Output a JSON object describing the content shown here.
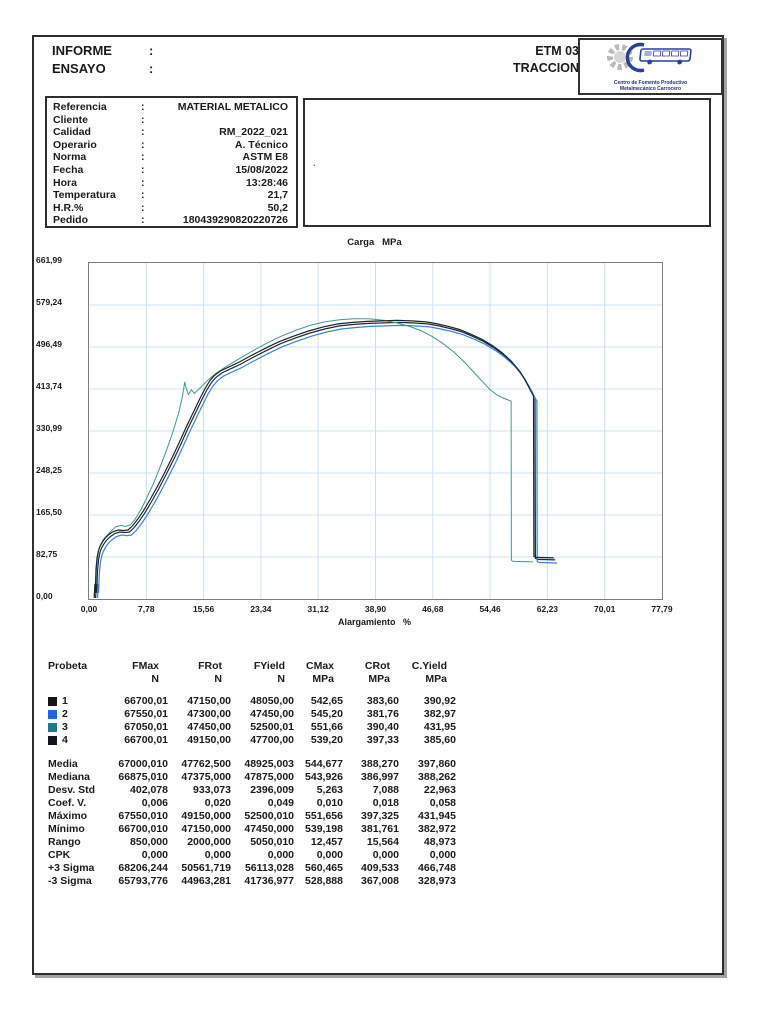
{
  "header": {
    "informe_label": "INFORME",
    "ensayo_label": "ENSAYO",
    "colon": ":",
    "code": "ETM 03",
    "test": "TRACCION",
    "logo_line1": "Centro de Fomento Productivo",
    "logo_line2": "Metalmecánico Carrocero"
  },
  "metadata": {
    "rows": [
      {
        "label": "Referencia",
        "value": "MATERIAL METALICO"
      },
      {
        "label": "Cliente",
        "value": ""
      },
      {
        "label": "Calidad",
        "value": "RM_2022_021"
      },
      {
        "label": "Operario",
        "value": "A. Técnico"
      },
      {
        "label": "Norma",
        "value": "ASTM E8"
      },
      {
        "label": "Fecha",
        "value": "15/08/2022"
      },
      {
        "label": "Hora",
        "value": "13:28:46"
      },
      {
        "label": "Temperatura",
        "value": "21,7"
      },
      {
        "label": "H.R.%",
        "value": "50,2"
      },
      {
        "label": "Pedido",
        "value": "180439290820220726"
      }
    ]
  },
  "note": {
    "dot": "."
  },
  "chart_data": {
    "type": "line",
    "title": "Carga   MPa",
    "xlabel": "Alargamiento   %",
    "ylabel": "Carga MPa",
    "xlim": [
      0,
      77.79
    ],
    "ylim": [
      0,
      661.99
    ],
    "grid": true,
    "x_ticks": [
      "0,00",
      "7,78",
      "15,56",
      "23,34",
      "31,12",
      "38,90",
      "46,68",
      "54,46",
      "62,23",
      "70,01",
      "77,79"
    ],
    "y_ticks": [
      "0,00",
      "82,75",
      "165,50",
      "248,25",
      "330,99",
      "413,74",
      "496,49",
      "579,24",
      "661,99"
    ],
    "grid_color": "#cfe0ef",
    "series": [
      {
        "name": "1",
        "color": "#23272c",
        "point_set": "cluster",
        "dx": 0,
        "dy": 0
      },
      {
        "name": "2",
        "color": "#3b82d8",
        "point_set": "cluster",
        "dx": 0.25,
        "dy": -6
      },
      {
        "name": "3",
        "color": "#43998b",
        "point_set": "probe3",
        "dx": 0,
        "dy": 0
      },
      {
        "name": "4",
        "color": "#182430",
        "point_set": "cluster",
        "dx": -0.2,
        "dy": 4
      }
    ],
    "point_sets": {
      "cluster": [
        [
          0.9,
          2
        ],
        [
          1.0,
          30
        ],
        [
          1.05,
          12
        ],
        [
          1.15,
          55
        ],
        [
          1.3,
          78
        ],
        [
          1.5,
          92
        ],
        [
          1.7,
          100
        ],
        [
          2.0,
          108
        ],
        [
          2.4,
          116
        ],
        [
          2.9,
          123
        ],
        [
          3.5,
          129
        ],
        [
          4.2,
          132
        ],
        [
          4.9,
          131
        ],
        [
          5.5,
          132
        ],
        [
          6.1,
          140
        ],
        [
          6.8,
          153
        ],
        [
          7.6,
          170
        ],
        [
          8.5,
          192
        ],
        [
          9.5,
          218
        ],
        [
          10.5,
          246
        ],
        [
          11.5,
          275
        ],
        [
          12.5,
          306
        ],
        [
          13.5,
          338
        ],
        [
          14.5,
          368
        ],
        [
          15.3,
          392
        ],
        [
          16.0,
          412
        ],
        [
          16.6,
          426
        ],
        [
          17.2,
          436
        ],
        [
          18.0,
          445
        ],
        [
          19.0,
          452
        ],
        [
          20.5,
          462
        ],
        [
          22,
          474
        ],
        [
          24,
          489
        ],
        [
          26,
          503
        ],
        [
          28,
          514
        ],
        [
          30,
          524
        ],
        [
          32,
          532
        ],
        [
          34,
          538
        ],
        [
          36,
          541
        ],
        [
          38,
          543
        ],
        [
          40,
          544
        ],
        [
          42,
          545
        ],
        [
          44,
          544
        ],
        [
          46,
          542
        ],
        [
          47.5,
          538
        ],
        [
          49,
          533
        ],
        [
          50.5,
          527
        ],
        [
          52,
          518
        ],
        [
          53.5,
          508
        ],
        [
          55,
          495
        ],
        [
          56.3,
          481
        ],
        [
          57.5,
          465
        ],
        [
          58.5,
          448
        ],
        [
          59.3,
          430
        ],
        [
          59.9,
          414
        ],
        [
          60.3,
          402
        ],
        [
          60.55,
          396
        ],
        [
          60.6,
          80
        ],
        [
          60.9,
          78
        ],
        [
          63.3,
          77
        ]
      ],
      "probe3": [
        [
          0.7,
          2
        ],
        [
          0.8,
          25
        ],
        [
          0.85,
          10
        ],
        [
          0.95,
          45
        ],
        [
          1.1,
          75
        ],
        [
          1.3,
          95
        ],
        [
          1.6,
          108
        ],
        [
          2.0,
          118
        ],
        [
          2.5,
          126
        ],
        [
          3.0,
          134
        ],
        [
          3.6,
          142
        ],
        [
          4.3,
          145
        ],
        [
          5.0,
          143
        ],
        [
          5.6,
          146
        ],
        [
          6.2,
          156
        ],
        [
          7.0,
          175
        ],
        [
          7.8,
          198
        ],
        [
          8.7,
          226
        ],
        [
          9.6,
          258
        ],
        [
          10.5,
          292
        ],
        [
          11.4,
          330
        ],
        [
          12.2,
          368
        ],
        [
          12.7,
          400
        ],
        [
          13.0,
          428
        ],
        [
          13.2,
          415
        ],
        [
          13.5,
          403
        ],
        [
          13.9,
          412
        ],
        [
          14.3,
          405
        ],
        [
          14.8,
          412
        ],
        [
          15.4,
          420
        ],
        [
          16.2,
          432
        ],
        [
          17.2,
          444
        ],
        [
          18.5,
          457
        ],
        [
          20,
          470
        ],
        [
          22,
          487
        ],
        [
          24,
          503
        ],
        [
          26,
          517
        ],
        [
          28,
          529
        ],
        [
          30,
          539
        ],
        [
          32,
          546
        ],
        [
          34,
          550
        ],
        [
          36,
          552
        ],
        [
          38,
          552
        ],
        [
          40,
          549
        ],
        [
          41.8,
          544
        ],
        [
          43.5,
          537
        ],
        [
          45,
          529
        ],
        [
          46.5,
          518
        ],
        [
          48,
          504
        ],
        [
          49.5,
          487
        ],
        [
          51,
          466
        ],
        [
          52.3,
          446
        ],
        [
          53.5,
          427
        ],
        [
          54.5,
          412
        ],
        [
          55.4,
          402
        ],
        [
          56.2,
          396
        ],
        [
          56.9,
          392
        ],
        [
          57.3,
          390
        ],
        [
          57.35,
          76
        ],
        [
          57.6,
          74
        ],
        [
          60.3,
          73
        ]
      ]
    }
  },
  "results_table": {
    "col1_header": "Probeta",
    "headers": [
      "FMax",
      "FRot",
      "FYield",
      "CMax",
      "CRot",
      "C.Yield"
    ],
    "units": [
      "N",
      "N",
      "N",
      "MPa",
      "MPa",
      "MPa"
    ],
    "rows": [
      {
        "id": "1",
        "color": "#151515",
        "values": [
          "66700,01",
          "47150,00",
          "48050,00",
          "542,65",
          "383,60",
          "390,92"
        ]
      },
      {
        "id": "2",
        "color": "#1e64e8",
        "values": [
          "67550,01",
          "47300,00",
          "47450,00",
          "545,20",
          "381,76",
          "382,97"
        ]
      },
      {
        "id": "3",
        "color": "#1d7c8a",
        "values": [
          "67050,01",
          "47450,00",
          "52500,01",
          "551,66",
          "390,40",
          "431,95"
        ]
      },
      {
        "id": "4",
        "color": "#10161c",
        "values": [
          "66700,01",
          "49150,00",
          "47700,00",
          "539,20",
          "397,33",
          "385,60"
        ]
      }
    ],
    "stats": [
      {
        "label": "Media",
        "values": [
          "67000,010",
          "47762,500",
          "48925,003",
          "544,677",
          "388,270",
          "397,860"
        ]
      },
      {
        "label": "Mediana",
        "values": [
          "66875,010",
          "47375,000",
          "47875,000",
          "543,926",
          "386,997",
          "388,262"
        ]
      },
      {
        "label": "Desv. Std",
        "values": [
          "402,078",
          "933,073",
          "2396,009",
          "5,263",
          "7,088",
          "22,963"
        ]
      },
      {
        "label": "Coef. V.",
        "values": [
          "0,006",
          "0,020",
          "0,049",
          "0,010",
          "0,018",
          "0,058"
        ]
      },
      {
        "label": "Máximo",
        "values": [
          "67550,010",
          "49150,000",
          "52500,010",
          "551,656",
          "397,325",
          "431,945"
        ]
      },
      {
        "label": "Mínimo",
        "values": [
          "66700,010",
          "47150,000",
          "47450,000",
          "539,198",
          "381,761",
          "382,972"
        ]
      },
      {
        "label": "Rango",
        "values": [
          "850,000",
          "2000,000",
          "5050,010",
          "12,457",
          "15,564",
          "48,973"
        ]
      },
      {
        "label": "CPK",
        "values": [
          "0,000",
          "0,000",
          "0,000",
          "0,000",
          "0,000",
          "0,000"
        ]
      },
      {
        "label": "+3 Sigma",
        "values": [
          "68206,244",
          "50561,719",
          "56113,028",
          "560,465",
          "409,533",
          "466,748"
        ]
      },
      {
        "label": "-3 Sigma",
        "values": [
          "65793,776",
          "44963,281",
          "41736,977",
          "528,888",
          "367,008",
          "328,973"
        ]
      }
    ]
  }
}
